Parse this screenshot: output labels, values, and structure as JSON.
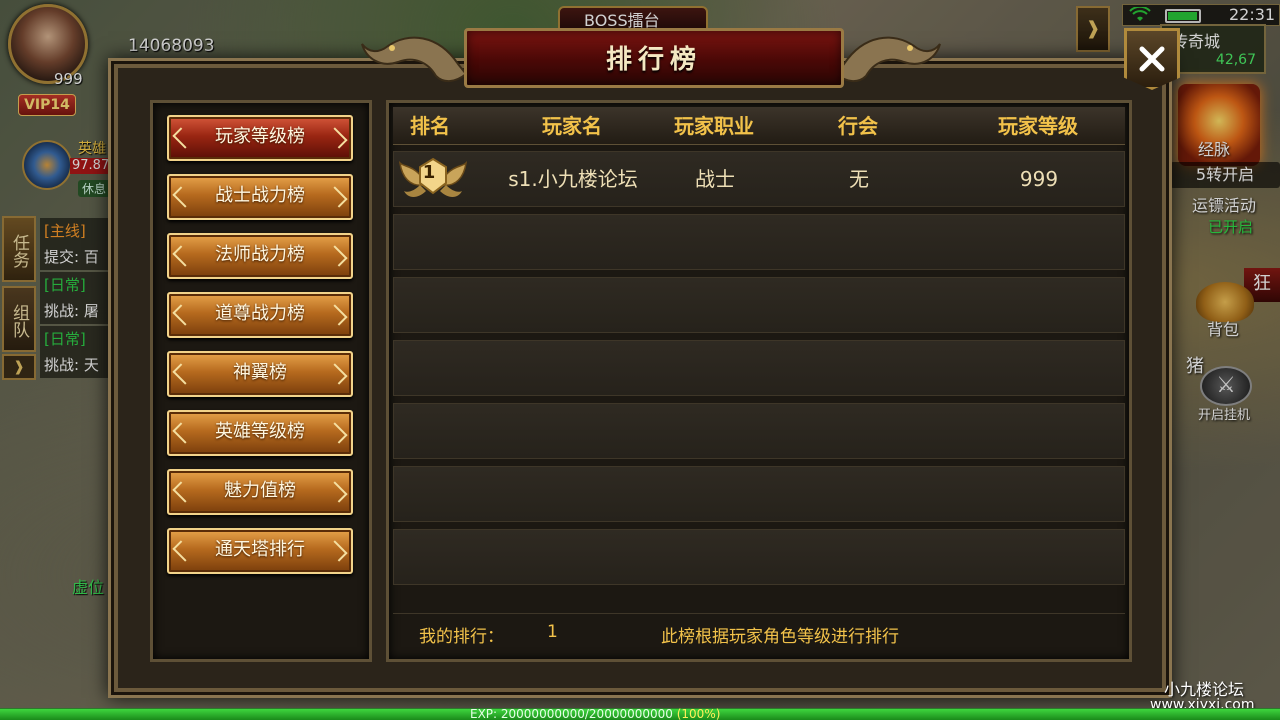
{
  "hud": {
    "avatar_level": "999",
    "vip": "VIP14",
    "gold": "14068093",
    "hero_label": "英雄",
    "hero_hp": "97.87",
    "hero_state": "休息",
    "quest_tab": "任务",
    "team_tab": "组队",
    "quests": [
      {
        "tag": "[主线]",
        "text": "提交: 百"
      },
      {
        "tag": "[日常]",
        "text": "挑战: 屠"
      },
      {
        "tag": "[日常]",
        "text": "挑战: 天"
      }
    ],
    "virtual_pos": "虚位",
    "boss_banner": "BOSS擂台",
    "clock": "22:31",
    "map_name": "传奇城",
    "map_coords": "42,67",
    "meridian": "经脉",
    "rebirth": "5转开启",
    "escort": "运镖活动",
    "escort_status": "已开启",
    "wild_tag": "狂",
    "bag": "背包",
    "pig": "猪",
    "auto_battle": "开启挂机",
    "watermark": "小九楼论坛",
    "watermark_url": "www.xjyxi.com",
    "exp_text": "EXP: 20000000000/20000000000",
    "exp_pct": "(100%)",
    "exp_fraction": 1.0
  },
  "modal": {
    "title": "排行榜",
    "categories": [
      "玩家等级榜",
      "战士战力榜",
      "法师战力榜",
      "道尊战力榜",
      "神翼榜",
      "英雄等级榜",
      "魅力值榜",
      "通天塔排行"
    ],
    "columns": [
      "排名",
      "玩家名",
      "玩家职业",
      "行会",
      "玩家等级"
    ],
    "rows": [
      {
        "rank": "1",
        "name": "s1.小九楼论坛",
        "class": "战士",
        "guild": "无",
        "level": "999"
      }
    ],
    "my_rank_label": "我的排行：",
    "my_rank_value": "1",
    "note": "此榜根据玩家角色等级进行排行"
  }
}
